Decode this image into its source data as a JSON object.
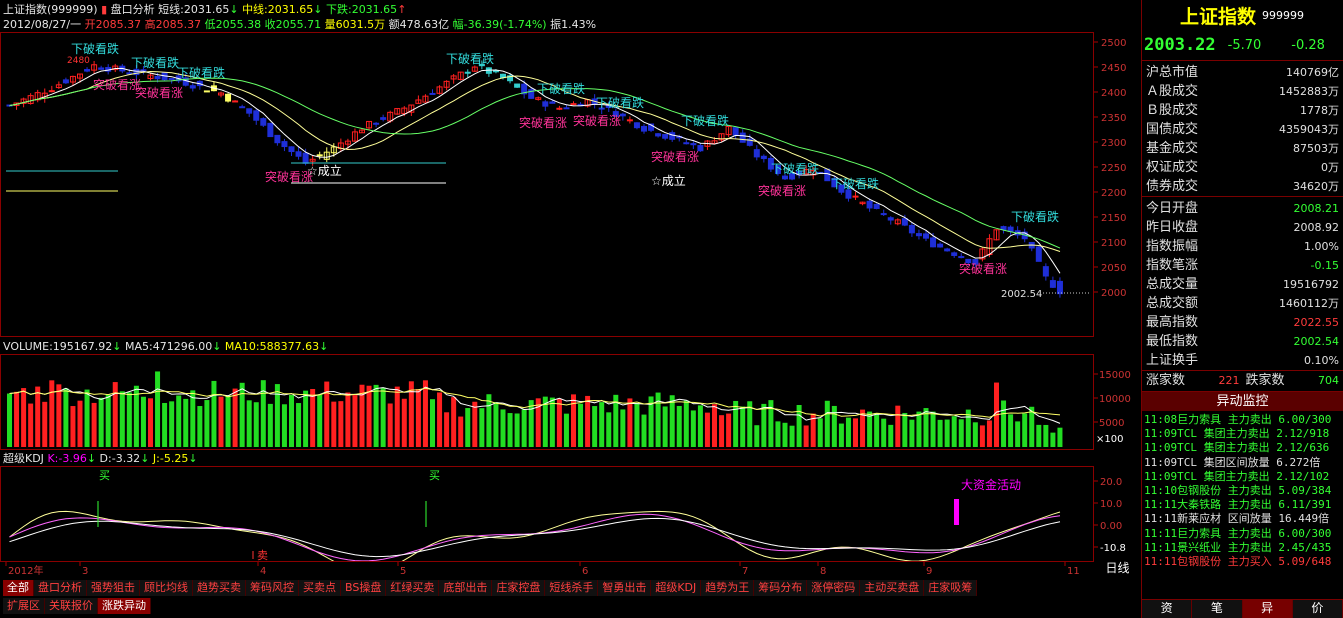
{
  "header": {
    "index_name": "上证指数(999999)",
    "button_label": "盘口分析",
    "short_line": "短线:2031.65",
    "mid_line": "中线:2031.65",
    "down_line": "下跌:2031.65",
    "ohlc": "2012/08/27/一",
    "open": "开2085.37",
    "high": "高2085.37",
    "low": "低2055.38",
    "close": "收2055.71",
    "volume": "量6031.5万",
    "amount": "额478.63亿",
    "change": "幅-36.39(-1.74%)",
    "amplitude": "振1.43%"
  },
  "price_axis": [
    "2500",
    "2450",
    "2400",
    "2350",
    "2300",
    "2250",
    "2200",
    "2150",
    "2100",
    "2050",
    "2000"
  ],
  "price_annotations": {
    "last_low": "2002.54",
    "break_down": "下破看跌",
    "break_up": "突破看涨",
    "star": "☆成立",
    "top_small": "2480"
  },
  "volume_header": {
    "volume": "VOLUME:195167.92",
    "ma5": "MA5:471296.00",
    "ma10": "MA10:588377.63"
  },
  "volume_axis": [
    "15000",
    "10000",
    "5000"
  ],
  "volume_unit": "×100",
  "kdj_header": {
    "name": "超级KDJ",
    "k": "K:-3.96",
    "d": "D:-3.32",
    "j": "J:-5.25"
  },
  "kdj_axis": [
    "20.0",
    "10.0",
    "0.00",
    "-10.8"
  ],
  "kdj_annotations": {
    "buy": "买",
    "sell": "卖",
    "big_money": "大资金活动"
  },
  "time_axis": [
    "2012年",
    "3",
    "4",
    "5",
    "6",
    "7",
    "8",
    "9",
    "11"
  ],
  "period_label": "日线",
  "tabs_row1": [
    "全部",
    "盘口分析",
    "强势狙击",
    "顾比均线",
    "趋势买卖",
    "筹码风控",
    "买卖点",
    "BS操盘",
    "红绿买卖",
    "底部出击",
    "庄家控盘",
    "短线杀手",
    "智勇出击",
    "超级KDJ",
    "趋势为王",
    "筹码分布",
    "涨停密码",
    "主动买卖盘",
    "庄家吸筹"
  ],
  "tabs_row2": [
    "扩展区",
    "关联报价",
    "涨跌异动"
  ],
  "right": {
    "title": "上证指数",
    "code": "999999",
    "price": "2003.22",
    "change": "-5.70",
    "change_pct": "-0.28",
    "stats": [
      {
        "k": "沪总市值",
        "v": "140769亿",
        "c": "#e0e0e0"
      },
      {
        "k": "Ａ股成交",
        "v": "1452883万",
        "c": "#e0e0e0"
      },
      {
        "k": "Ｂ股成交",
        "v": "1778万",
        "c": "#e0e0e0"
      },
      {
        "k": "国债成交",
        "v": "4359043万",
        "c": "#e0e0e0"
      },
      {
        "k": "基金成交",
        "v": "87503万",
        "c": "#e0e0e0"
      },
      {
        "k": "权证成交",
        "v": "0万",
        "c": "#e0e0e0"
      },
      {
        "k": "债券成交",
        "v": "34620万",
        "c": "#e0e0e0"
      }
    ],
    "stats2": [
      {
        "k": "今日开盘",
        "v": "2008.21",
        "c": "#33ff33"
      },
      {
        "k": "昨日收盘",
        "v": "2008.92",
        "c": "#e0e0e0"
      },
      {
        "k": "指数振幅",
        "v": "1.00%",
        "c": "#e0e0e0"
      },
      {
        "k": "指数笔涨",
        "v": "-0.15",
        "c": "#33ff33"
      },
      {
        "k": "总成交量",
        "v": "19516792",
        "c": "#e0e0e0"
      },
      {
        "k": "总成交额",
        "v": "1460112万",
        "c": "#e0e0e0"
      },
      {
        "k": "最高指数",
        "v": "2022.55",
        "c": "#ff3b3b"
      },
      {
        "k": "最低指数",
        "v": "2002.54",
        "c": "#33ff33"
      },
      {
        "k": "上证换手",
        "v": "0.10%",
        "c": "#e0e0e0"
      }
    ],
    "up_label": "涨家数",
    "up_count": "221",
    "down_label": "跌家数",
    "down_count": "704",
    "monitor_title": "异动监控",
    "monitor": [
      {
        "t": "11:08巨力索具 主力卖出 6.00/300",
        "c": "#33ff33"
      },
      {
        "t": "11:09TCL 集团主力卖出 2.12/918",
        "c": "#33ff33"
      },
      {
        "t": "11:09TCL 集团主力卖出 2.12/636",
        "c": "#33ff33"
      },
      {
        "t": "11:09TCL 集团区间放量 6.272倍",
        "c": "#e0e0e0"
      },
      {
        "t": "11:09TCL 集团主力卖出 2.12/102",
        "c": "#33ff33"
      },
      {
        "t": "11:10包钢股份 主力卖出 5.09/384",
        "c": "#33ff33"
      },
      {
        "t": "11:11大秦铁路 主力卖出 6.11/391",
        "c": "#33ff33"
      },
      {
        "t": "11:11新莱应材 区间放量 16.449倍",
        "c": "#e0e0e0"
      },
      {
        "t": "11:11巨力索具 主力卖出 6.00/300",
        "c": "#33ff33"
      },
      {
        "t": "11:11景兴纸业 主力卖出 2.45/435",
        "c": "#33ff33"
      },
      {
        "t": "11:11包钢股份 主力买入 5.09/648",
        "c": "#ff3b3b"
      }
    ],
    "bottom_tabs": [
      "资",
      "笔",
      "异",
      "价"
    ]
  },
  "colors": {
    "up": "#ff2020",
    "down": "#1f2fd8",
    "vol_up": "#ff2020",
    "vol_down": "#22dd22",
    "ma_white": "#ffffff",
    "ma_yellow": "#ffff66",
    "ma_green": "#66ff66"
  }
}
